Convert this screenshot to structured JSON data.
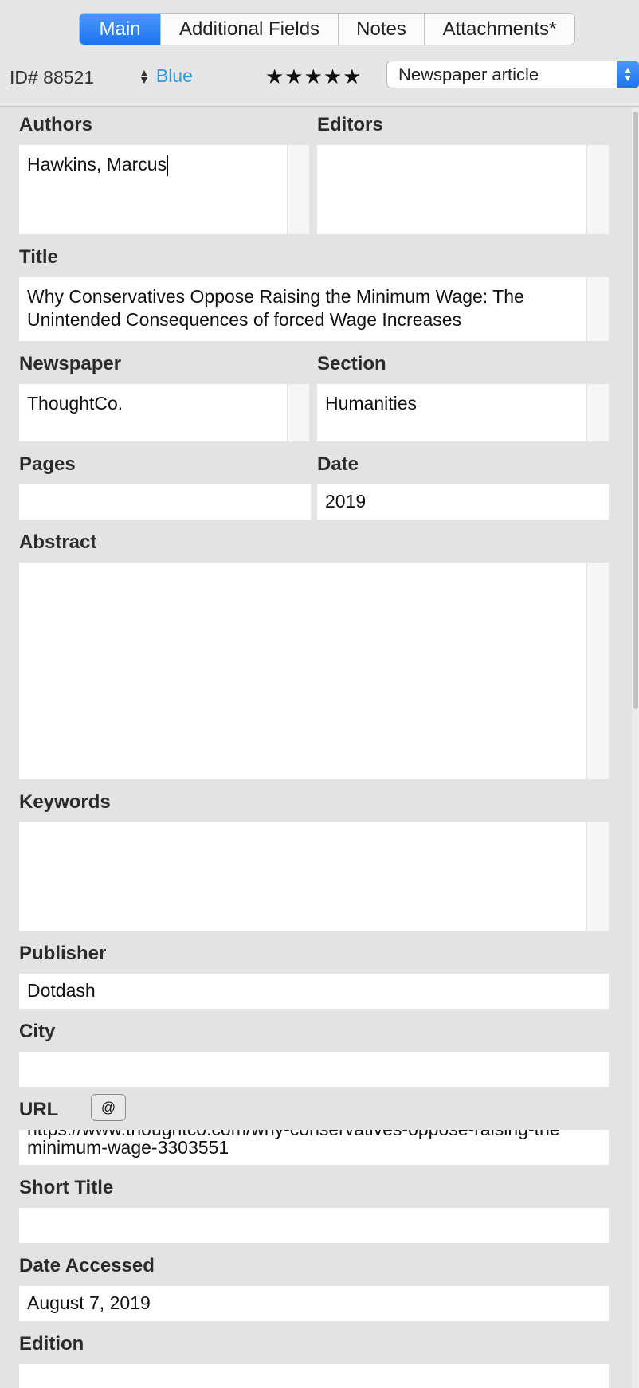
{
  "tabs": [
    {
      "label": "Main",
      "active": true
    },
    {
      "label": "Additional Fields",
      "active": false
    },
    {
      "label": "Notes",
      "active": false
    },
    {
      "label": "Attachments*",
      "active": false
    }
  ],
  "meta": {
    "id_label": "ID#  88521",
    "color_label": "Blue",
    "rating_stars": "★★★★★",
    "type_value": "Newspaper article"
  },
  "fields": {
    "authors": {
      "label": "Authors",
      "value": "Hawkins, Marcus"
    },
    "editors": {
      "label": "Editors",
      "value": ""
    },
    "title": {
      "label": "Title",
      "value": "Why Conservatives Oppose Raising the Minimum Wage: The Unintended Consequences of forced Wage Increases"
    },
    "newspaper": {
      "label": "Newspaper",
      "value": "ThoughtCo."
    },
    "section": {
      "label": "Section",
      "value": "Humanities"
    },
    "pages": {
      "label": "Pages",
      "value": ""
    },
    "date": {
      "label": "Date",
      "value": "2019"
    },
    "abstract": {
      "label": "Abstract",
      "value": ""
    },
    "keywords": {
      "label": "Keywords",
      "value": ""
    },
    "publisher": {
      "label": "Publisher",
      "value": "Dotdash"
    },
    "city": {
      "label": "City",
      "value": ""
    },
    "url": {
      "label": "URL",
      "value_line1": "https://www.thoughtco.com/why-conservatives-oppose-raising-the",
      "value_line2": "minimum-wage-3303551",
      "at_symbol": "@"
    },
    "short_title": {
      "label": "Short Title",
      "value": ""
    },
    "date_accessed": {
      "label": "Date Accessed",
      "value": "August 7, 2019"
    },
    "edition": {
      "label": "Edition",
      "value": ""
    }
  }
}
